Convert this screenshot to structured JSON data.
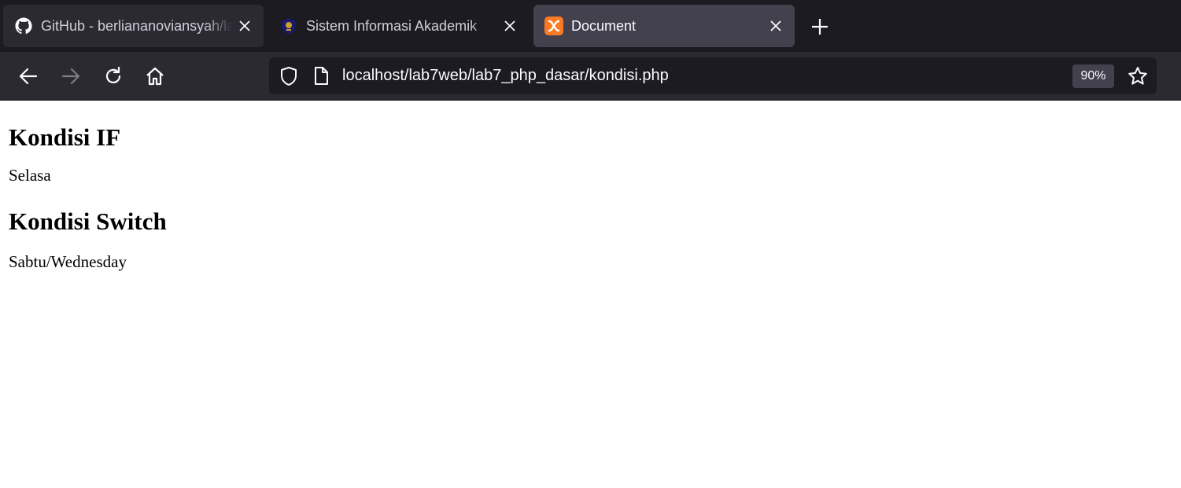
{
  "tabs": [
    {
      "title": "GitHub - berliananoviansyah/la",
      "favicon": "github-icon",
      "active": false
    },
    {
      "title": "Sistem Informasi Akademik",
      "favicon": "university-logo-icon",
      "active": false
    },
    {
      "title": "Document",
      "favicon": "xampp-icon",
      "active": true
    }
  ],
  "toolbar": {
    "url": "localhost/lab7web/lab7_php_dasar/kondisi.php",
    "zoom": "90%"
  },
  "page": {
    "heading_if": "Kondisi IF",
    "result_if": "Selasa",
    "heading_switch": "Kondisi Switch",
    "result_switch": "Sabtu/Wednesday"
  },
  "colors": {
    "tabbar_bg": "#1c1b22",
    "toolbar_bg": "#2b2a33",
    "active_tab_bg": "#42414d",
    "xampp_orange": "#fb7a24"
  }
}
